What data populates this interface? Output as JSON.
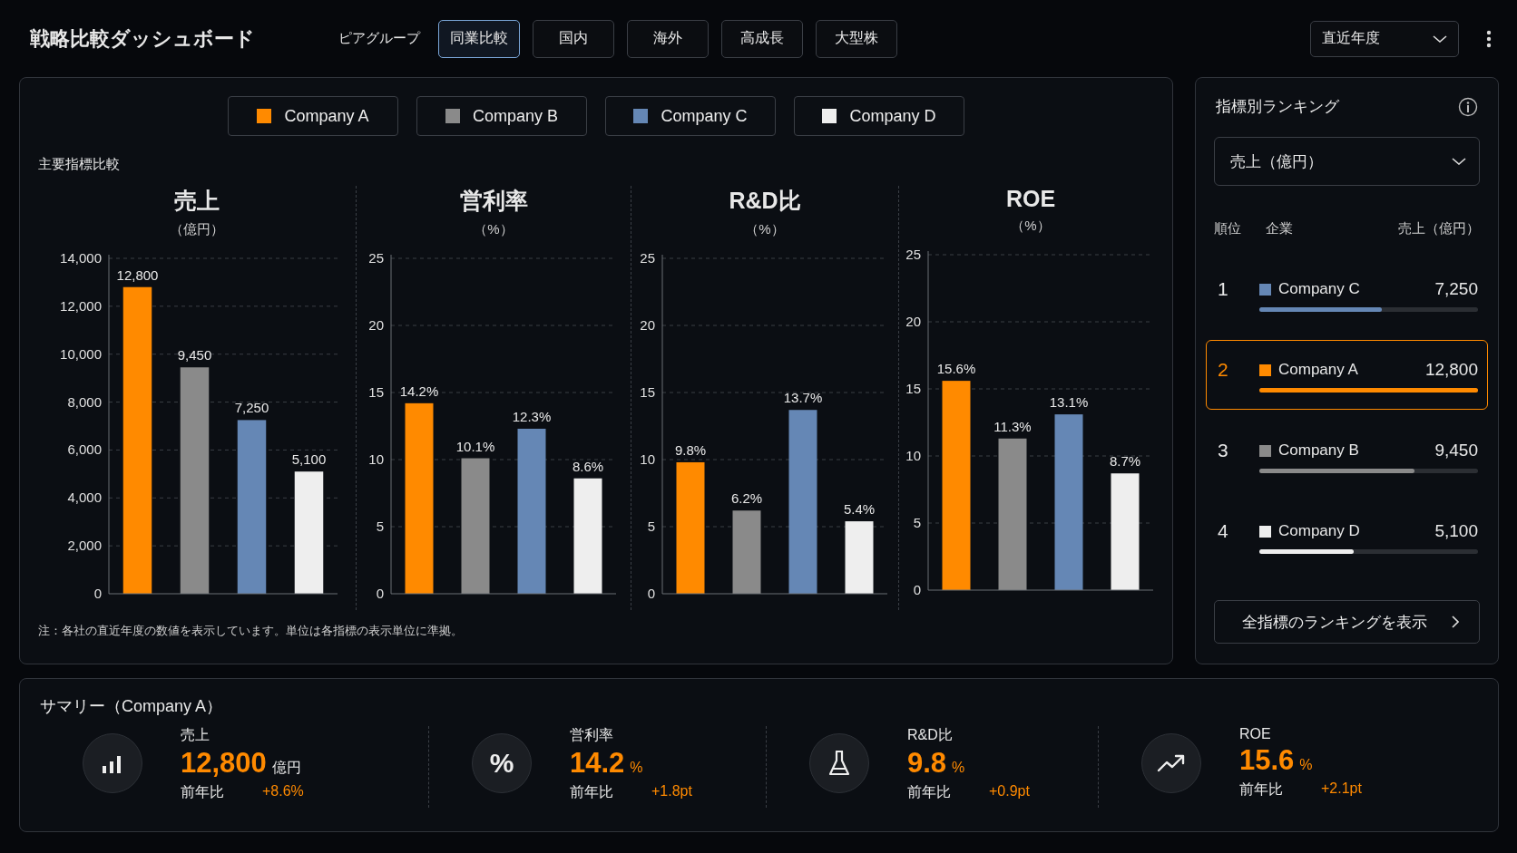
{
  "header": {
    "title": "戦略比較ダッシュボード",
    "peer_group_label": "ピアグループ",
    "tabs": [
      {
        "label": "同業比較",
        "selected": true
      },
      {
        "label": "国内",
        "selected": false
      },
      {
        "label": "海外",
        "selected": false
      },
      {
        "label": "高成長",
        "selected": false
      },
      {
        "label": "大型株",
        "selected": false
      }
    ],
    "period_select": {
      "value": "直近年度"
    }
  },
  "legend": [
    {
      "name": "Company A",
      "color": "#ff8a00"
    },
    {
      "name": "Company B",
      "color": "#8a8a8a"
    },
    {
      "name": "Company C",
      "color": "#6587b5"
    },
    {
      "name": "Company D",
      "color": "#eeeeee"
    }
  ],
  "comparison": {
    "title": "主要指標比較",
    "charts": [
      {
        "chart_data": {
          "type": "bar",
          "title": "売上",
          "ylabel": "（億円）",
          "ylim": [
            0,
            14000
          ],
          "yticks": [
            {
              "value": 0,
              "label": "0"
            },
            {
              "value": 2000,
              "label": "2,000"
            },
            {
              "value": 4000,
              "label": "4,000"
            },
            {
              "value": 6000,
              "label": "6,000"
            },
            {
              "value": 8000,
              "label": "8,000"
            },
            {
              "value": 10000,
              "label": "10,000"
            },
            {
              "value": 12000,
              "label": "12,000"
            },
            {
              "value": 14000,
              "label": "14,000"
            }
          ],
          "value_labels": [
            "12,800",
            "9,450",
            "7,250",
            "5,100"
          ],
          "grid": true,
          "values": [
            12800,
            9450,
            7250,
            5100
          ]
        }
      },
      {
        "chart_data": {
          "type": "bar",
          "title": "営利率",
          "ylabel": "（%）",
          "ylim": [
            0,
            25
          ],
          "yticks": [
            0,
            5,
            10,
            15,
            20,
            25
          ],
          "value_labels": [
            "14.2%",
            "10.1%",
            "12.3%",
            "8.6%"
          ],
          "grid": true,
          "values": [
            14.2,
            10.1,
            12.3,
            8.6
          ]
        }
      },
      {
        "chart_data": {
          "type": "bar",
          "title": "R&D比",
          "ylabel": "（%）",
          "ylim": [
            0,
            25
          ],
          "yticks": [
            0,
            5,
            10,
            15,
            20,
            25
          ],
          "value_labels": [
            "9.8%",
            "6.2%",
            "13.7%",
            "5.4%"
          ],
          "grid": true,
          "values": [
            9.8,
            6.2,
            13.7,
            5.4
          ]
        }
      },
      {
        "chart_data": {
          "type": "bar",
          "title": "ROE",
          "ylabel": "（%）",
          "ylim": [
            0,
            25
          ],
          "yticks": [
            0,
            5,
            10,
            15,
            20,
            25
          ],
          "value_labels": [
            "15.6%",
            "11.3%",
            "13.1%",
            "8.7%"
          ],
          "grid": true,
          "values": [
            15.6,
            11.3,
            13.1,
            8.7
          ]
        }
      }
    ],
    "note": "注：各社の直近年度の数値を表示しています。単位は各指標の表示単位に準拠。"
  },
  "ranking": {
    "title": "指標別ランキング",
    "metric_select": {
      "value": "売上（億円）"
    },
    "columns": [
      "順位",
      "企業",
      "売上（億円）"
    ],
    "rows": [
      {
        "rank": "1",
        "company": "Company C",
        "color": "#6587b5",
        "value": "7,250",
        "level": 0.56,
        "selected": false
      },
      {
        "rank": "2",
        "company": "Company A",
        "color": "#ff8a00",
        "value": "12,800",
        "level": 1,
        "selected": true
      },
      {
        "rank": "3",
        "company": "Company B",
        "color": "#8a8a8a",
        "value": "9,450",
        "level": 0.71,
        "selected": false
      },
      {
        "rank": "4",
        "company": "Company D",
        "color": "#eeeeee",
        "value": "5,100",
        "level": 0.43,
        "selected": false
      }
    ],
    "show_all_button": "全指標のランキングを表示"
  },
  "summary": {
    "title": "サマリー（Company A）",
    "items": [
      {
        "kind": "bars",
        "label": "売上",
        "value": "12,800",
        "unit": "億円",
        "change_label": "前年比",
        "change": "+8.6%"
      },
      {
        "kind": "percent",
        "icon": "%",
        "label": "営利率",
        "value": "14.2",
        "unit": "%",
        "change_label": "前年比",
        "change": "+1.8pt"
      },
      {
        "kind": "flask",
        "label": "R&D比",
        "value": "9.8",
        "unit": "%",
        "change_label": "前年比",
        "change": "+0.9pt"
      },
      {
        "kind": "trend",
        "label": "ROE",
        "value": "15.6",
        "unit": "%",
        "change_label": "前年比",
        "change": "+2.1pt"
      }
    ]
  }
}
